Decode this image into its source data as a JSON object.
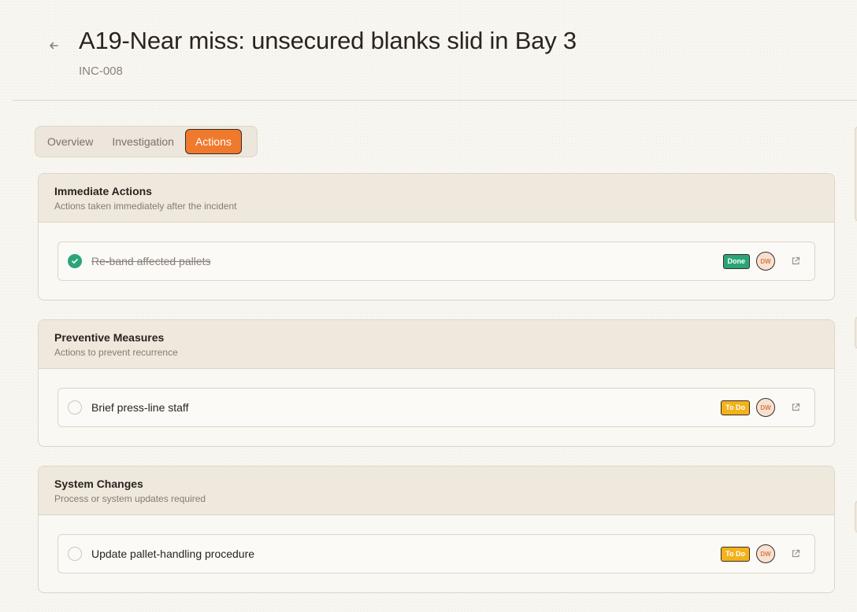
{
  "header": {
    "title": "A19-Near miss: unsecured blanks slid in Bay 3",
    "subtitle": "INC-008"
  },
  "tabs": [
    {
      "label": "Overview",
      "active": false
    },
    {
      "label": "Investigation",
      "active": false
    },
    {
      "label": "Actions",
      "active": true
    }
  ],
  "sections": [
    {
      "title": "Immediate Actions",
      "description": "Actions taken immediately after the incident",
      "actions": [
        {
          "label": "Re-band affected pallets",
          "status": "Done",
          "assignee": "DW",
          "completed": true
        }
      ]
    },
    {
      "title": "Preventive Measures",
      "description": "Actions to prevent recurrence",
      "actions": [
        {
          "label": "Brief press-line staff",
          "status": "To Do",
          "assignee": "DW",
          "completed": false
        }
      ]
    },
    {
      "title": "System Changes",
      "description": "Process or system updates required",
      "actions": [
        {
          "label": "Update pallet-handling procedure",
          "status": "To Do",
          "assignee": "DW",
          "completed": false
        }
      ]
    }
  ],
  "colors": {
    "accent": "#ef7a2e",
    "done": "#2aa57a",
    "todo": "#f2b21c",
    "background": "#f8f6f0"
  },
  "icons": {
    "back": "arrow-left-icon",
    "check": "check-icon",
    "link": "external-link-icon"
  }
}
